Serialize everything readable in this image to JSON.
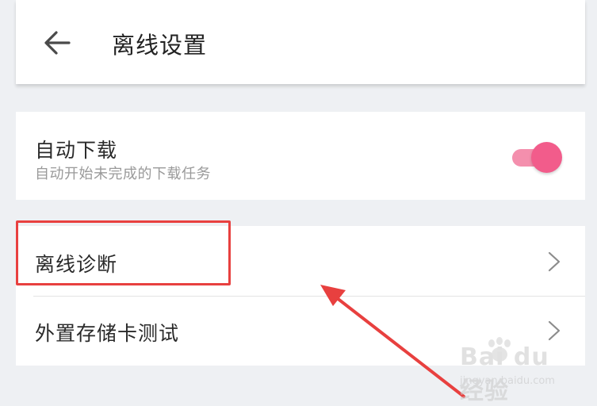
{
  "header": {
    "back_icon": "arrow-left-icon",
    "title": "离线设置"
  },
  "auto_download": {
    "title": "自动下载",
    "subtitle": "自动开始未完成的下载任务",
    "toggle_on": true,
    "toggle_color": "#f25c8b"
  },
  "list": {
    "items": [
      {
        "label": "离线诊断",
        "icon": "chevron-right-icon"
      },
      {
        "label": "外置存储卡测试",
        "icon": "chevron-right-icon"
      }
    ]
  },
  "annotation": {
    "box_color": "#e8403f",
    "arrow_color": "#e8403f"
  },
  "watermark": {
    "main": "Bai du 经验",
    "sub": "jingyan.baidu.com"
  }
}
